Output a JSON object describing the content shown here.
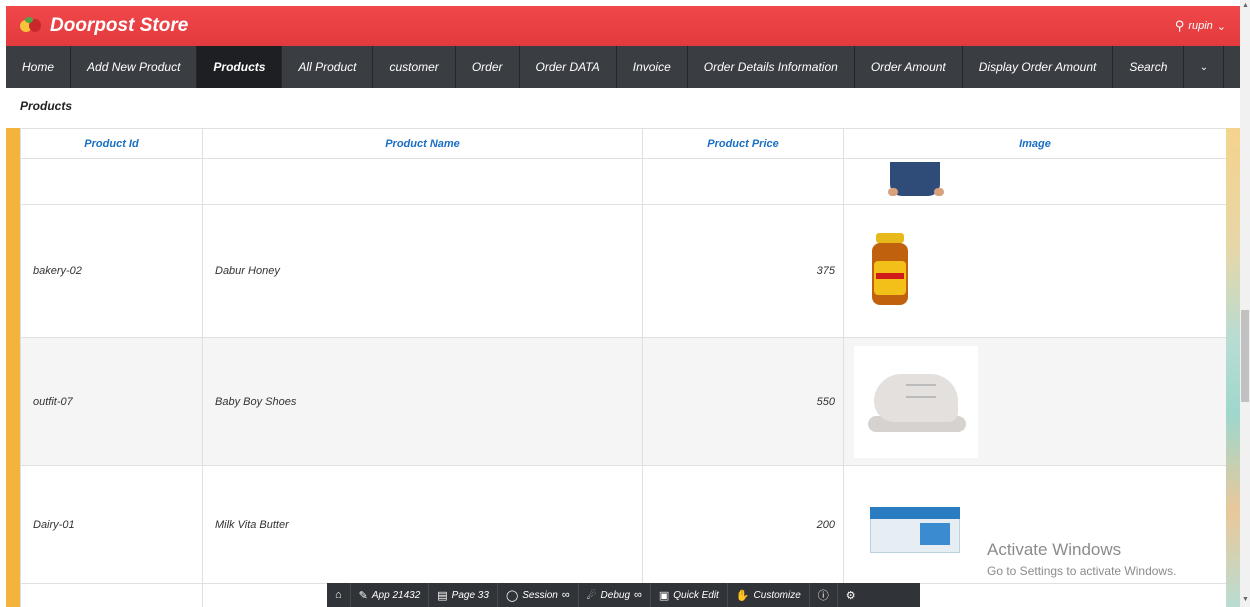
{
  "header": {
    "brand": "Doorpost Store",
    "user": "rupin"
  },
  "nav": {
    "items": [
      "Home",
      "Add New Product",
      "Products",
      "All Product",
      "customer",
      "Order",
      "Order DATA",
      "Invoice",
      "Order Details Information",
      "Order Amount",
      "Display Order Amount",
      "Search"
    ],
    "active": "Products"
  },
  "breadcrumb": "Products",
  "table": {
    "headers": [
      "Product Id",
      "Product Name",
      "Product Price",
      "Image"
    ],
    "rows": [
      {
        "id": "",
        "name": "",
        "price": "",
        "image": "shirt"
      },
      {
        "id": "bakery-02",
        "name": "Dabur Honey",
        "price": "375",
        "image": "honey-jar"
      },
      {
        "id": "outfit-07",
        "name": "Baby Boy Shoes",
        "price": "550",
        "image": "baby-shoe"
      },
      {
        "id": "Dairy-01",
        "name": "Milk Vita Butter",
        "price": "200",
        "image": "butter-box"
      }
    ]
  },
  "watermark": {
    "title": "Activate Windows",
    "subtitle": "Go to Settings to activate Windows."
  },
  "devbar": {
    "app": "App 21432",
    "page": "Page 33",
    "session": "Session",
    "debug": "Debug",
    "quick_edit": "Quick Edit",
    "customize": "Customize"
  },
  "colors": {
    "header": "#e23a3d",
    "nav": "#3a3e43",
    "accent": "#f4b33c",
    "link": "#1a6fc4"
  }
}
